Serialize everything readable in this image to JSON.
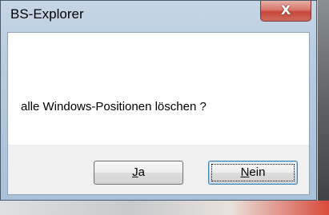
{
  "window": {
    "title": "BS-Explorer",
    "close_glyph": "X"
  },
  "dialog": {
    "message": "alle Windows-Positionen löschen ?"
  },
  "buttons": {
    "yes": {
      "accel": "J",
      "rest": "a"
    },
    "no": {
      "accel": "N",
      "rest": "ein"
    }
  }
}
